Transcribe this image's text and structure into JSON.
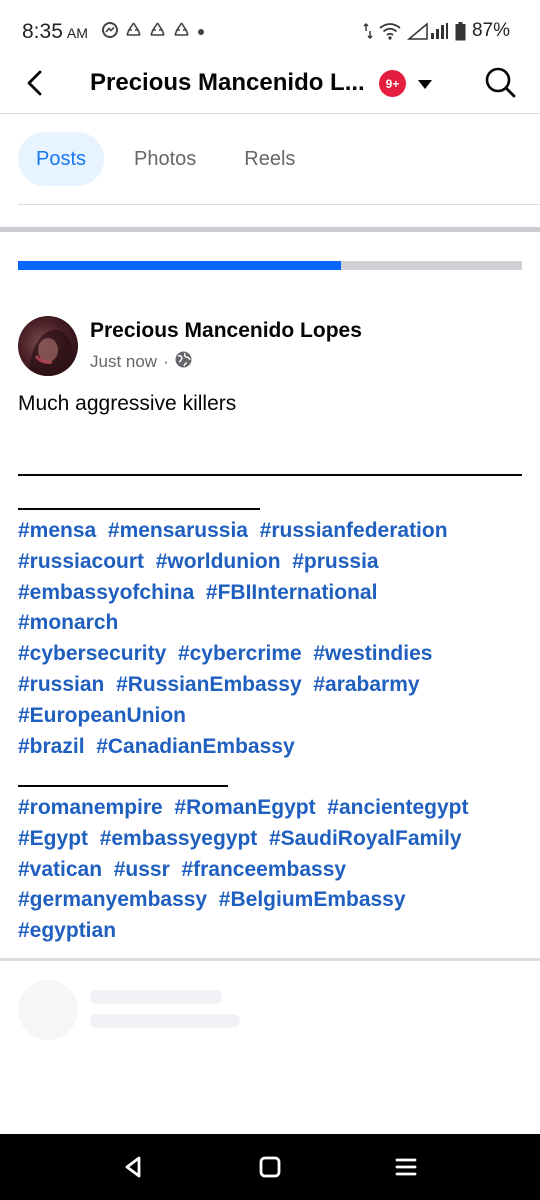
{
  "status": {
    "time": "8:35",
    "ampm": "AM",
    "notification_icons": [
      "messenger-icon",
      "recycle-icon",
      "recycle-icon",
      "recycle-icon",
      "dot-icon"
    ],
    "battery": "87%"
  },
  "header": {
    "title": "Precious Mancenido L...",
    "badge": "9+"
  },
  "tabs": [
    {
      "label": "Posts",
      "active": true
    },
    {
      "label": "Photos",
      "active": false
    },
    {
      "label": "Reels",
      "active": false
    }
  ],
  "progress": {
    "fraction": 0.64
  },
  "post": {
    "author": "Precious Mancenido Lopes",
    "time": "Just now",
    "separator": "·",
    "text": "Much aggressive killers",
    "hashtag_group_1": [
      [
        "#mensa",
        "#mensarussia",
        "#russianfederation"
      ],
      [
        "#russiacourt",
        "#worldunion",
        "#prussia"
      ],
      [
        "#embassyofchina",
        "#FBIInternational"
      ],
      [
        "#monarch"
      ],
      [
        "#cybersecurity",
        "#cybercrime",
        "#westindies"
      ],
      [
        "#russian",
        "#RussianEmbassy",
        "#arabarmy"
      ],
      [
        "#EuropeanUnion"
      ],
      [
        "#brazil",
        "#CanadianEmbassy"
      ]
    ],
    "hashtag_group_2": [
      [
        "#romanempire",
        "#RomanEgypt",
        "#ancientegypt"
      ],
      [
        "#Egypt",
        "#embassyegypt",
        "#SaudiRoyalFamily"
      ],
      [
        "#vatican",
        "#ussr",
        "#franceembassy"
      ],
      [
        "#germanyembassy",
        "#BelgiumEmbassy"
      ],
      [
        "#egyptian"
      ]
    ]
  },
  "colors": {
    "accent": "#1877f2",
    "hashtag": "#1f5fbf",
    "badge": "#e41e3f",
    "progress": "#0866ff"
  }
}
